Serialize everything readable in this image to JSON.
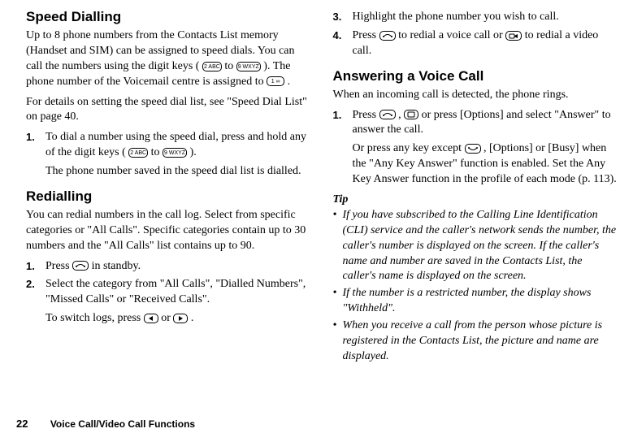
{
  "left": {
    "speed": {
      "heading": "Speed Dialling",
      "p1_a": "Up to 8 phone numbers from the Contacts List memory (Handset and SIM) can be assigned to speed dials. You can call the numbers using the digit keys (",
      "p1_b": " to ",
      "p1_c": "). The phone number of the Voicemail centre is assigned to ",
      "p1_d": ".",
      "p2": "For details on setting the speed dial list, see \"Speed Dial List\" on page 40.",
      "li1_a": "To dial a number using the speed dial, press and hold any of the digit keys (",
      "li1_b": " to ",
      "li1_c": ").",
      "li1_sub": "The phone number saved in the speed dial list is dialled."
    },
    "redial": {
      "heading": "Redialling",
      "p1": "You can redial numbers in the call log. Select from specific categories or \"All Calls\". Specific categories contain up to 30 numbers and the \"All Calls\" list contains up to 90.",
      "li1_a": "Press ",
      "li1_b": " in standby.",
      "li2_a": "Select the category from \"All Calls\", \"Dialled Numbers\", \"Missed Calls\" or \"Received Calls\".",
      "li2_sub_a": "To switch logs, press ",
      "li2_sub_b": " or ",
      "li2_sub_c": "."
    }
  },
  "right": {
    "li3": "Highlight the phone number you wish to call.",
    "li4_a": "Press ",
    "li4_b": " to redial a voice call or ",
    "li4_c": " to redial a video call.",
    "answer": {
      "heading": "Answering a Voice Call",
      "p1": "When an incoming call is detected, the phone rings.",
      "li1_a": "Press ",
      "li1_b": ", ",
      "li1_c": " or press [Options] and select \"Answer\" to answer the call.",
      "li1_sub_a": "Or press any key except ",
      "li1_sub_b": ", [Options] or [Busy] when the \"Any Key Answer\" function is enabled. Set the Any Key Answer function in the profile of each mode (p. 113)."
    },
    "tip": {
      "head": "Tip",
      "t1": "If you have subscribed to the Calling Line Identification (CLI) service and the caller's network sends the number, the caller's number is displayed on the screen. If the caller's name and number are saved in the Contacts List, the caller's name is displayed on the screen.",
      "t2": "If the number is a restricted number, the display shows \"Withheld\".",
      "t3": "When you receive a call from the person whose picture is registered in the Contacts List, the picture and name are displayed."
    }
  },
  "footer": {
    "page": "22",
    "title": "Voice Call/Video Call Functions"
  },
  "keys": {
    "d1": "1 ∞",
    "d2": "2 ABC",
    "d9": "9 WXYZ"
  }
}
